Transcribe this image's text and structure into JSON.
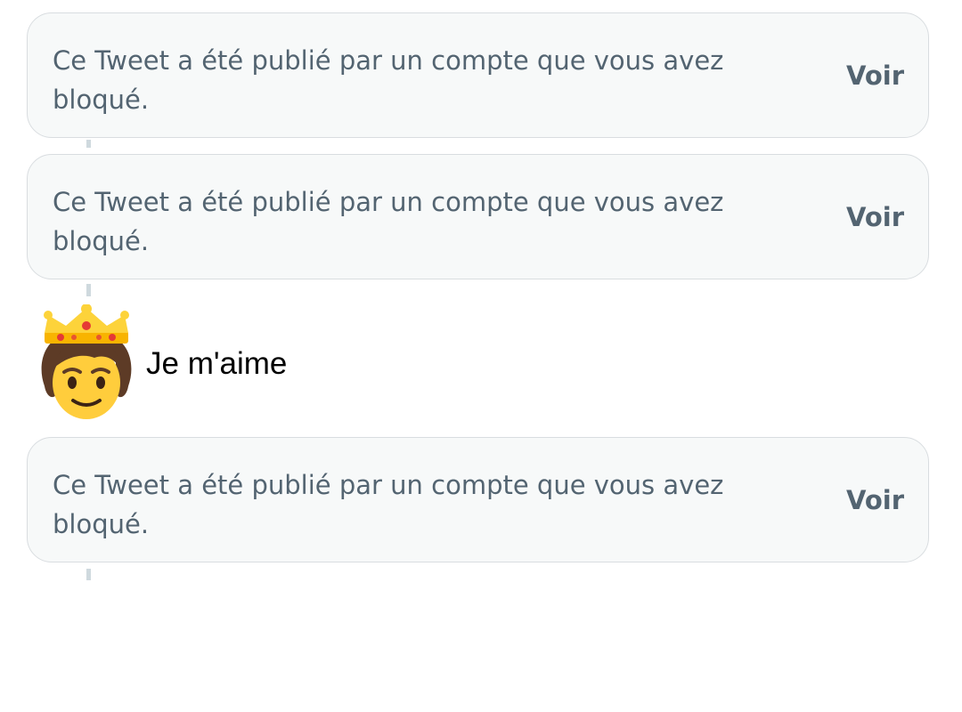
{
  "blocked_tweets": [
    {
      "text": "Ce Tweet a été publié par un compte que vous avez bloqué.",
      "action": "Voir"
    },
    {
      "text": "Ce Tweet a été publié par un compte que vous avez bloqué.",
      "action": "Voir"
    },
    {
      "text": "Ce Tweet a été publié par un compte que vous avez bloqué.",
      "action": "Voir"
    }
  ],
  "reply": {
    "icon": "crowned-person-emoji",
    "text": "Je m'aime"
  },
  "colors": {
    "card_background": "#f7f9f9",
    "card_border": "#d9dde0",
    "secondary_text": "#536471",
    "thread_line": "#cfd9de"
  }
}
